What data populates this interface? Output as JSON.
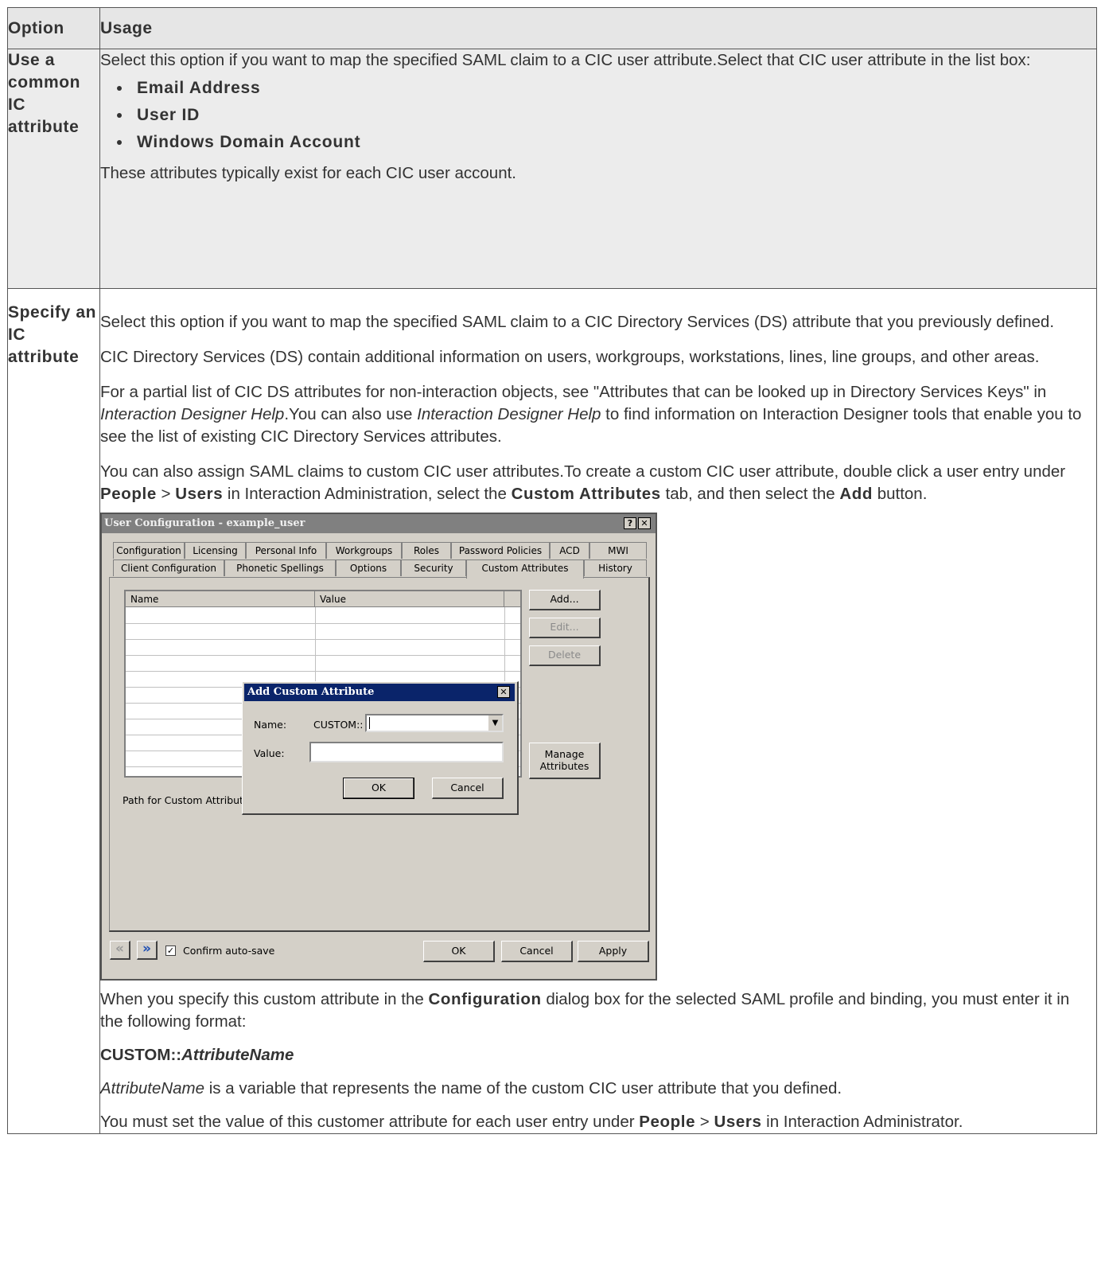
{
  "table": {
    "headers": [
      "Option",
      "Usage"
    ],
    "row1": {
      "option": "Use a common IC attribute",
      "intro": "Select this option if you want to map the specified SAML claim to a CIC user attribute.Select that CIC user attribute in the list box:",
      "bullets": [
        "Email Address",
        "User ID",
        "Windows Domain Account"
      ],
      "note": "These attributes typically exist for each CIC user account."
    },
    "row2": {
      "option": "Specify an IC attribute",
      "p1": "Select this option if you want to map the specified SAML claim to a CIC Directory Services (DS) attribute that you previously defined.",
      "p2": "CIC Directory Services (DS) contain additional information on users, workgroups, workstations, lines, line groups, and other areas.",
      "p3_a": "For a partial list of CIC DS attributes for non-interaction objects, see \"Attributes that can be looked up in Directory Services Keys\" in ",
      "p3_b": "Interaction Designer Help",
      "p3_c": ".You can also use ",
      "p3_d": "Interaction Designer Help",
      "p3_e": " to find information on Interaction Designer tools that enable you to see the list of existing CIC Directory Services attributes.",
      "p4_a": "You can also assign SAML claims to custom CIC user attributes.To create a custom CIC user attribute, double click a user entry under ",
      "p4_people": "People",
      "p4_gt1": " > ",
      "p4_users": "Users",
      "p4_b": " in Interaction Administration, select the ",
      "p4_custom": "Custom Attributes",
      "p4_c": " tab, and then select the ",
      "p4_add": "Add",
      "p4_d": " button.",
      "p5_a": "When you specify this custom attribute in the ",
      "p5_conf": "Configuration",
      "p5_b": " dialog box for the selected SAML profile and binding, you must enter it in the following format:",
      "format_prefix": "CUSTOM::",
      "format_var": "AttributeName",
      "p6_var": "AttributeName",
      "p6_rest": " is a variable that represents the name of the custom CIC user attribute that you defined.",
      "p7_a": "You must set the value of this customer attribute for each user entry under ",
      "p7_people": "People",
      "p7_gt": " > ",
      "p7_users": "Users",
      "p7_b": " in Interaction Administrator."
    }
  },
  "screenshot": {
    "window_title": "User Configuration - example_user",
    "title_buttons": [
      "?",
      "✕"
    ],
    "tabs_row1": [
      "Configuration",
      "Licensing",
      "Personal Info",
      "Workgroups",
      "Roles",
      "Password Policies",
      "ACD",
      "MWI"
    ],
    "tabs_row2": [
      "Client Configuration",
      "Phonetic Spellings",
      "Options",
      "Security",
      "Custom Attributes",
      "History"
    ],
    "grid_columns": [
      "Name",
      "Value"
    ],
    "buttons": {
      "add": "Add...",
      "edit": "Edit...",
      "delete": "Delete",
      "manage_line1": "Manage",
      "manage_line2": "Attributes"
    },
    "path_label": "Path for Custom Attributes",
    "dialog": {
      "title": "Add Custom Attribute",
      "name_label": "Name:",
      "name_prefix": "CUSTOM::",
      "value_label": "Value:",
      "ok": "OK",
      "cancel": "Cancel"
    },
    "confirm_label": "Confirm auto-save",
    "footer_buttons": {
      "ok": "OK",
      "cancel": "Cancel",
      "apply": "Apply"
    }
  }
}
